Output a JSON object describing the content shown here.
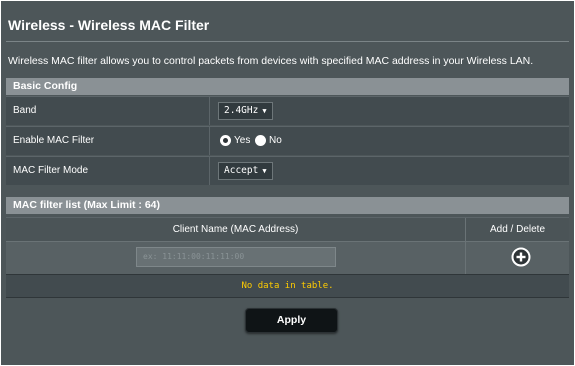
{
  "page": {
    "title": "Wireless - Wireless MAC Filter",
    "description": "Wireless MAC filter allows you to control packets from devices with specified MAC address in your Wireless LAN."
  },
  "basic_config": {
    "header": "Basic Config",
    "band": {
      "label": "Band",
      "value": "2.4GHz"
    },
    "enable_mac_filter": {
      "label": "Enable MAC Filter",
      "yes_label": "Yes",
      "no_label": "No",
      "selected": "Yes"
    },
    "mac_filter_mode": {
      "label": "MAC Filter Mode",
      "value": "Accept"
    }
  },
  "mac_filter_list": {
    "header": "MAC filter list (Max Limit : 64)",
    "columns": [
      "Client Name (MAC Address)",
      "Add / Delete"
    ],
    "input_placeholder": "ex: 11:11:00:11:11:00",
    "empty_text": "No data in table."
  },
  "actions": {
    "apply_label": "Apply"
  },
  "icons": {
    "caret": "caret-down-icon",
    "add": "plus-circle-icon"
  },
  "colors": {
    "background": "#4d5659",
    "section_header": "#8a9195",
    "empty_text": "#ffcc00"
  }
}
